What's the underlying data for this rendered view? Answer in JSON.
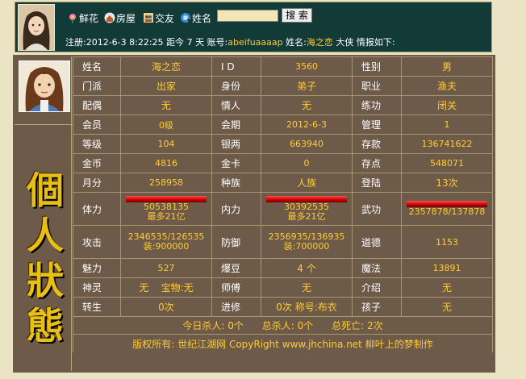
{
  "nav": {
    "flowers": "鲜花",
    "house": "房屋",
    "friends": "交友",
    "name": "姓名",
    "search_button": "搜 索"
  },
  "info": {
    "reg_label": "注册:",
    "reg_date": "2012-6-3 8:22:25",
    "ago_label": "距今",
    "ago_days": "7",
    "days_unit": "天",
    "account_label": "账号:",
    "account": "abeifuaaaap",
    "name_label": "姓名:",
    "name": "海之恋",
    "tail": "大侠 情报如下:"
  },
  "side_title": [
    "個",
    "人",
    "狀",
    "態"
  ],
  "stats": {
    "name": {
      "label": "姓名",
      "value": "海之恋"
    },
    "id": {
      "label": "I D",
      "value": "3560"
    },
    "gender": {
      "label": "性别",
      "value": "男"
    },
    "sect": {
      "label": "门派",
      "value": "出家"
    },
    "identity": {
      "label": "身份",
      "value": "弟子"
    },
    "job": {
      "label": "职业",
      "value": "渔夫"
    },
    "spouse": {
      "label": "配偶",
      "value": "无"
    },
    "lover": {
      "label": "情人",
      "value": "无"
    },
    "training": {
      "label": "练功",
      "value": "闭关"
    },
    "member": {
      "label": "会员",
      "value": "0级"
    },
    "term": {
      "label": "会期",
      "value": "2012-6-3"
    },
    "admin": {
      "label": "管理",
      "value": "1"
    },
    "level": {
      "label": "等级",
      "value": "104"
    },
    "silver": {
      "label": "银两",
      "value": "663940"
    },
    "deposit": {
      "label": "存款",
      "value": "136741622"
    },
    "gold": {
      "label": "金币",
      "value": "4816"
    },
    "goldcard": {
      "label": "金卡",
      "value": "0"
    },
    "points": {
      "label": "存点",
      "value": "548071"
    },
    "monthly": {
      "label": "月分",
      "value": "258958"
    },
    "race": {
      "label": "种族",
      "value": "人族"
    },
    "logins": {
      "label": "登陆",
      "value": "13次"
    },
    "hp": {
      "label": "体力",
      "value": "50538135",
      "sub": "最多21亿",
      "fill": 1.0
    },
    "mp": {
      "label": "内力",
      "value": "30392535",
      "sub": "最多21亿",
      "fill": 1.0
    },
    "martial": {
      "label": "武功",
      "value": "2357878/137878",
      "fill": 1.0
    },
    "attack": {
      "label": "攻击",
      "value": "2346535/126535",
      "sub": "装:900000"
    },
    "defense": {
      "label": "防御",
      "value": "2356935/136935",
      "sub": "装:700000"
    },
    "morality": {
      "label": "道德",
      "value": "1153"
    },
    "charm": {
      "label": "魅力",
      "value": "527"
    },
    "beans": {
      "label": "爆豆",
      "value": "4 个"
    },
    "magic": {
      "label": "魔法",
      "value": "13891"
    },
    "spirit": {
      "label": "神灵",
      "value": "无",
      "treasure": "宝物:无"
    },
    "master": {
      "label": "师傅",
      "value": "无"
    },
    "referrer": {
      "label": "介绍",
      "value": "无"
    },
    "rebirth": {
      "label": "转生",
      "value": "0次"
    },
    "advance": {
      "label": "进修",
      "value": "0次",
      "title_label": "称号:",
      "title": "布衣"
    },
    "child": {
      "label": "孩子",
      "value": "无"
    }
  },
  "summary": {
    "today_kills": "今日杀人: 0个",
    "total_kills": "总杀人: 0个",
    "total_deaths": "总死亡: 2次"
  },
  "footer": "版权所有: 世纪江湖网 CopyRight www.jhchina.net 柳叶上的梦制作",
  "colors": {
    "bar": "#c80000",
    "value_text": "#ffcc33",
    "panel": "#6e5a48",
    "header": "#123a36"
  }
}
